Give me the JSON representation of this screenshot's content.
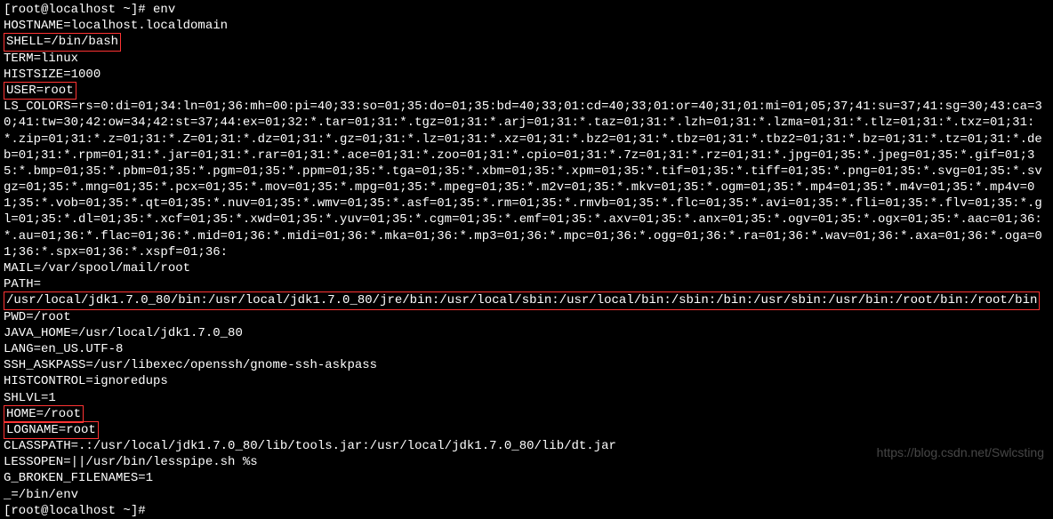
{
  "lines": {
    "l0": "[root@localhost ~]# env",
    "l1": "HOSTNAME=localhost.localdomain",
    "l2": "SHELL=/bin/bash",
    "l3": "TERM=linux",
    "l4": "HISTSIZE=1000",
    "l5": "USER=root",
    "ls_colors": "LS_COLORS=rs=0:di=01;34:ln=01;36:mh=00:pi=40;33:so=01;35:do=01;35:bd=40;33;01:cd=40;33;01:or=40;31;01:mi=01;05;37;41:su=37;41:sg=30;43:ca=30;41:tw=30;42:ow=34;42:st=37;44:ex=01;32:*.tar=01;31:*.tgz=01;31:*.arj=01;31:*.taz=01;31:*.lzh=01;31:*.lzma=01;31:*.tlz=01;31:*.txz=01;31:*.zip=01;31:*.z=01;31:*.Z=01;31:*.dz=01;31:*.gz=01;31:*.lz=01;31:*.xz=01;31:*.bz2=01;31:*.tbz=01;31:*.tbz2=01;31:*.bz=01;31:*.tz=01;31:*.deb=01;31:*.rpm=01;31:*.jar=01;31:*.rar=01;31:*.ace=01;31:*.zoo=01;31:*.cpio=01;31:*.7z=01;31:*.rz=01;31:*.jpg=01;35:*.jpeg=01;35:*.gif=01;35:*.bmp=01;35:*.pbm=01;35:*.pgm=01;35:*.ppm=01;35:*.tga=01;35:*.xbm=01;35:*.xpm=01;35:*.tif=01;35:*.tiff=01;35:*.png=01;35:*.svg=01;35:*.svgz=01;35:*.mng=01;35:*.pcx=01;35:*.mov=01;35:*.mpg=01;35:*.mpeg=01;35:*.m2v=01;35:*.mkv=01;35:*.ogm=01;35:*.mp4=01;35:*.m4v=01;35:*.mp4v=01;35:*.vob=01;35:*.qt=01;35:*.nuv=01;35:*.wmv=01;35:*.asf=01;35:*.rm=01;35:*.rmvb=01;35:*.flc=01;35:*.avi=01;35:*.fli=01;35:*.flv=01;35:*.gl=01;35:*.dl=01;35:*.xcf=01;35:*.xwd=01;35:*.yuv=01;35:*.cgm=01;35:*.emf=01;35:*.axv=01;35:*.anx=01;35:*.ogv=01;35:*.ogx=01;35:*.aac=01;36:*.au=01;36:*.flac=01;36:*.mid=01;36:*.midi=01;36:*.mka=01;36:*.mp3=01;36:*.mpc=01;36:*.ogg=01;36:*.ra=01;36:*.wav=01;36:*.axa=01;36:*.oga=01;36:*.spx=01;36:*.xspf=01;36:",
    "l7": "MAIL=/var/spool/mail/root",
    "l8a": "PATH=",
    "l8b": "/usr/local/jdk1.7.0_80/bin:/usr/local/jdk1.7.0_80/jre/bin:/usr/local/sbin:/usr/local/bin:/sbin:/bin:/usr/sbin:/usr/bin:/root/bin:/root/bin",
    "l9": "PWD=/root",
    "l10": "JAVA_HOME=/usr/local/jdk1.7.0_80",
    "l11": "LANG=en_US.UTF-8",
    "l12": "SSH_ASKPASS=/usr/libexec/openssh/gnome-ssh-askpass",
    "l13": "HISTCONTROL=ignoredups",
    "l14": "SHLVL=1",
    "l15": "HOME=/root",
    "l16": "LOGNAME=root",
    "l17": "CLASSPATH=.:/usr/local/jdk1.7.0_80/lib/tools.jar:/usr/local/jdk1.7.0_80/lib/dt.jar",
    "l18": "LESSOPEN=||/usr/bin/lesspipe.sh %s",
    "l19": "G_BROKEN_FILENAMES=1",
    "l20": "_=/bin/env",
    "l21": "[root@localhost ~]#"
  },
  "watermark": "https://blog.csdn.net/Swlcsting"
}
